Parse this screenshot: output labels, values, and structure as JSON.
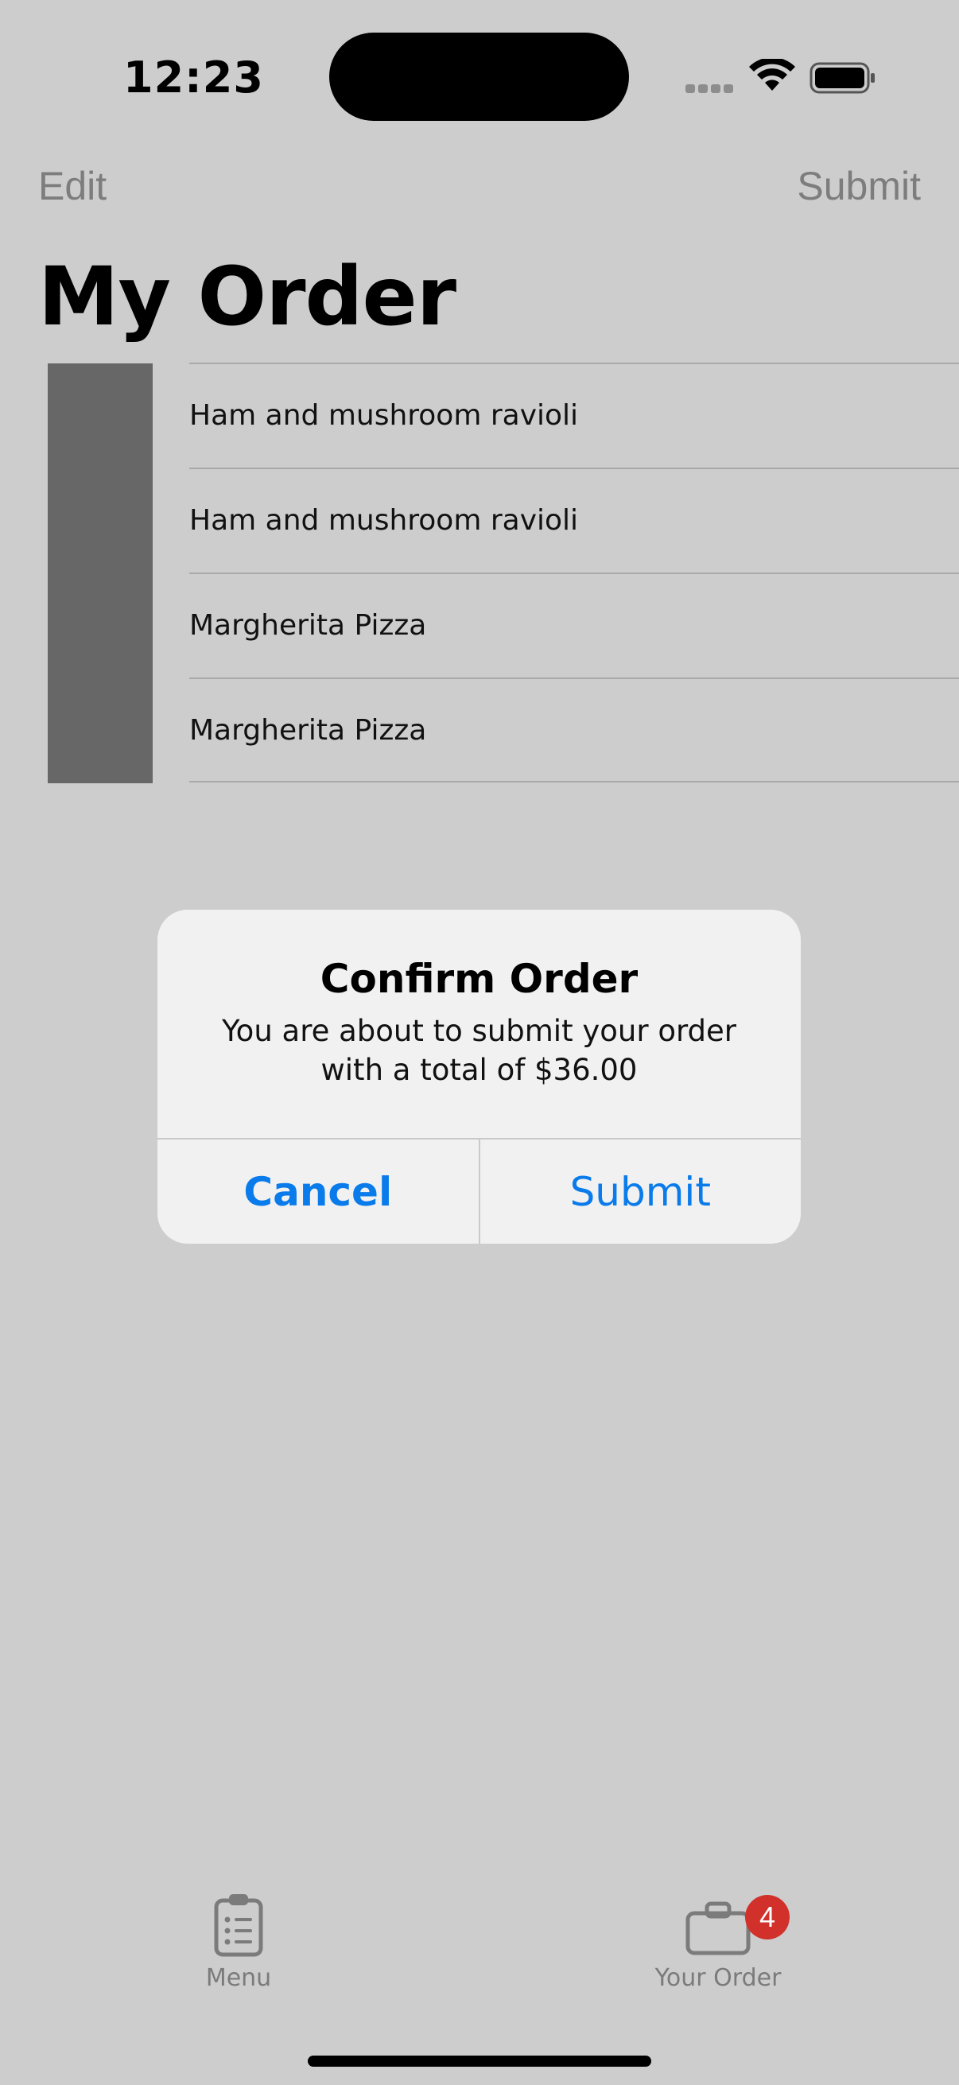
{
  "status_bar": {
    "time": "12:23"
  },
  "nav": {
    "edit_label": "Edit",
    "submit_label": "Submit"
  },
  "page_title": "My Order",
  "order_items": [
    "Ham and mushroom ravioli",
    "Ham and mushroom ravioli",
    "Margherita Pizza",
    "Margherita Pizza"
  ],
  "alert": {
    "title": "Confirm Order",
    "message": "You are about to submit your order with a total of $36.00",
    "cancel_label": "Cancel",
    "submit_label": "Submit"
  },
  "tabs": [
    {
      "label": "Menu",
      "icon": "clipboard-list-icon"
    },
    {
      "label": "Your Order",
      "icon": "briefcase-icon",
      "badge": "4"
    }
  ],
  "colors": {
    "accent": "#0a7bea",
    "badge": "#d1302b",
    "dimmed_text": "#7d7d7d"
  }
}
